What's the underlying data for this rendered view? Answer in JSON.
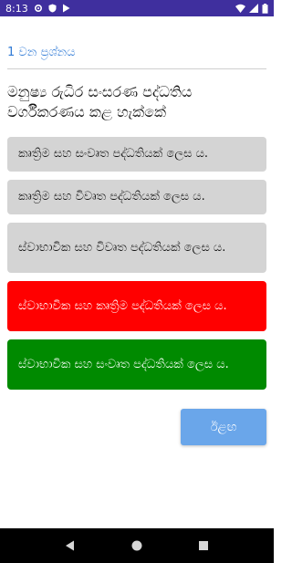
{
  "status_bar": {
    "time": "8:13",
    "icons": [
      "gear-icon",
      "shield-icon",
      "play-store-icon",
      "wifi-icon",
      "signal-icon",
      "battery-icon"
    ]
  },
  "question": {
    "number_label": "1 වන ප්‍රශ්නය",
    "text": "මනුෂ්‍ය රුධිර සංසරණ පද්ධතිය වර්ගීකරණය කළ හැක්කේ"
  },
  "answers": [
    {
      "label": "කෘත්‍රිම සහ සංවෘත පද්ධතියක් ලෙස ය.",
      "state": "neutral"
    },
    {
      "label": "කෘත්‍රිම සහ විවෘත පද්ධතියක් ලෙස ය.",
      "state": "neutral"
    },
    {
      "label": "ස්වාභාවික සහ විවෘත පද්ධතියක් ලෙස ය.",
      "state": "neutral"
    },
    {
      "label": "ස්වාභාවික සහ කෘත්‍රිම පද්ධතියක් ලෙස ය.",
      "state": "wrong"
    },
    {
      "label": "ස්වාභාවික සහ සංවෘත පද්ධතියක් ලෙස ය.",
      "state": "correct"
    }
  ],
  "next_button": {
    "label": "ඊළඟ"
  },
  "colors": {
    "status_bar": "#3f2f9e",
    "question_number": "#2f7ad6",
    "neutral": "#d4d4d4",
    "wrong": "#ff0000",
    "correct": "#008a00",
    "next_button": "#6aa6ea"
  },
  "nav_bar": {
    "icons": [
      "back-icon",
      "home-icon",
      "recents-icon"
    ]
  }
}
